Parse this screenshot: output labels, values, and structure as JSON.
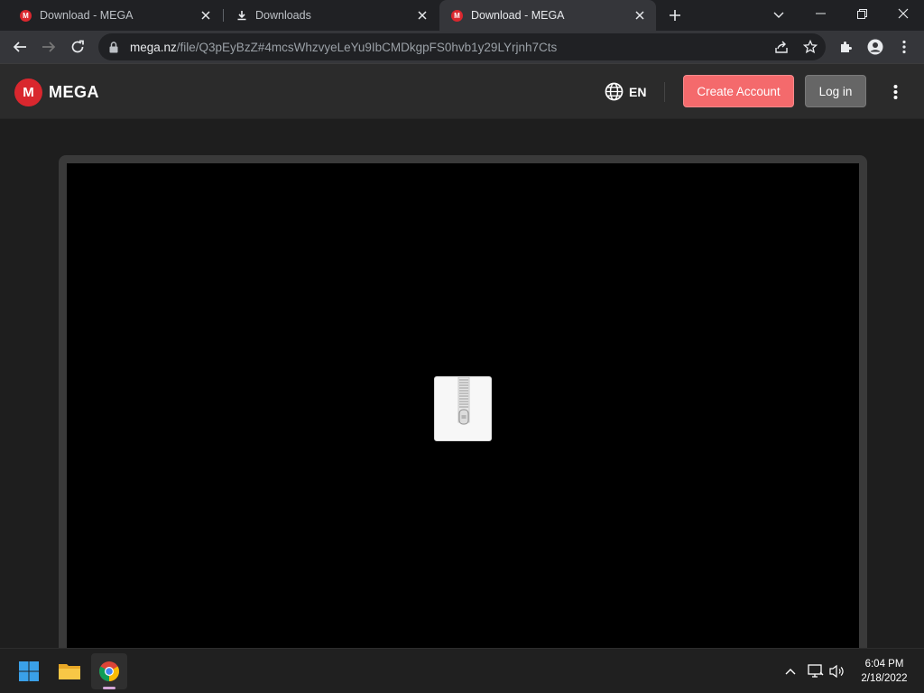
{
  "tabs": [
    {
      "label": "Download - MEGA",
      "icon": "mega-icon",
      "active": false
    },
    {
      "label": "Downloads",
      "icon": "download-icon",
      "active": false
    },
    {
      "label": "Download - MEGA",
      "icon": "mega-icon",
      "active": true
    }
  ],
  "browser": {
    "url_host": "mega.nz",
    "url_path": "/file/Q3pEyBzZ#4mcsWhzvyeLeYu9IbCMDkgpFS0hvb1y29LYrjnh7Cts"
  },
  "mega": {
    "logo_mark": "M",
    "logo_text": "MEGA",
    "language": "EN",
    "create_account_label": "Create Account",
    "login_label": "Log in",
    "preview_icon": "zip-archive-icon"
  },
  "colors": {
    "brand_red": "#d9272e",
    "create_account_bg": "#f46a6c",
    "login_bg": "#666666"
  },
  "taskbar": {
    "apps": [
      "windows-start-icon",
      "file-explorer-icon",
      "chrome-icon"
    ],
    "tray": [
      "chevron-up-icon",
      "network-icon",
      "volume-icon"
    ],
    "time": "6:04 PM",
    "date": "2/18/2022"
  }
}
